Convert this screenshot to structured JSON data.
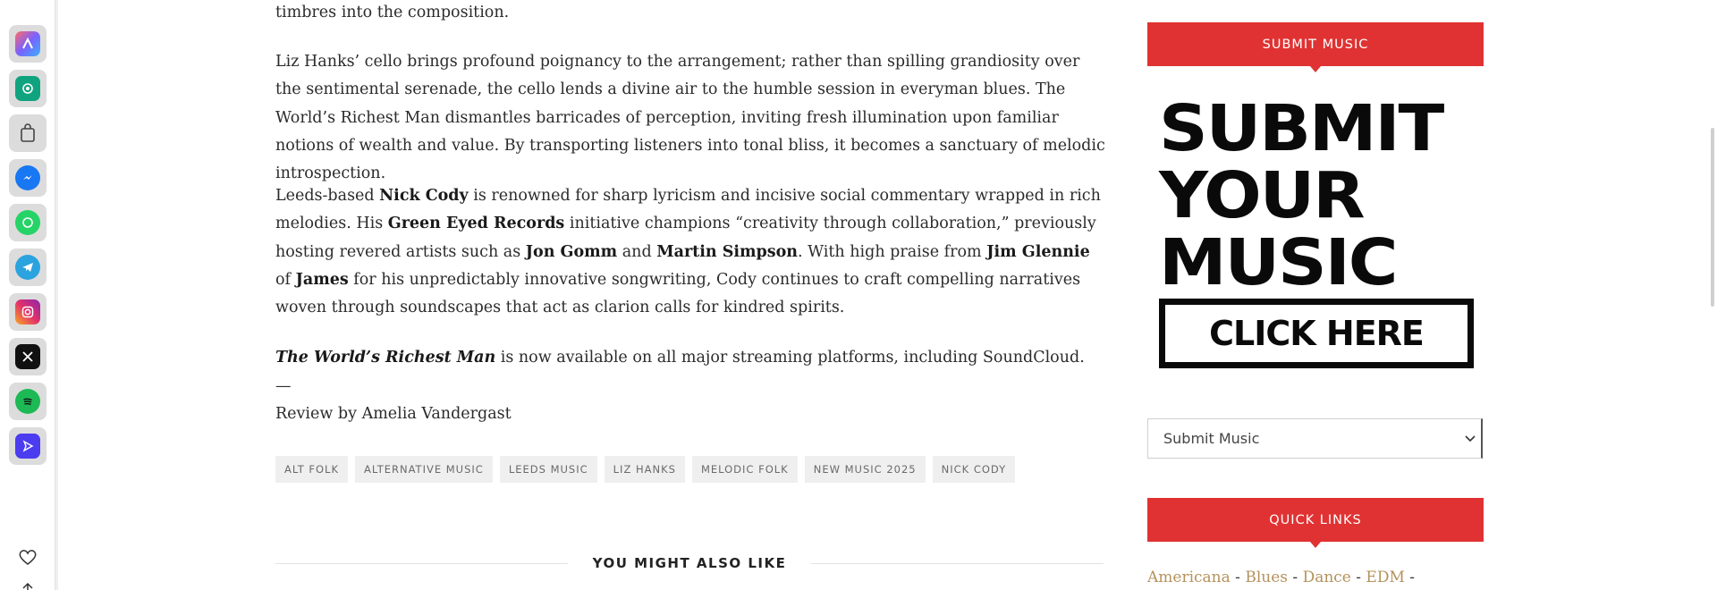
{
  "dock": {
    "items": [
      {
        "name": "arc-app-icon",
        "color": "#7b61ff"
      },
      {
        "name": "chatgpt-icon",
        "color": "#10a37f"
      },
      {
        "name": "shopping-bag-icon",
        "color": "#555555"
      },
      {
        "name": "messenger-icon",
        "color": "#1877f2"
      },
      {
        "name": "whatsapp-icon",
        "color": "#25d366"
      },
      {
        "name": "telegram-icon",
        "color": "#2aa3df"
      },
      {
        "name": "instagram-icon",
        "color": "#e1306c"
      },
      {
        "name": "x-icon",
        "color": "#111111"
      },
      {
        "name": "spotify-icon",
        "color": "#1db954"
      },
      {
        "name": "send-app-icon",
        "color": "#4b3cf0"
      }
    ],
    "bottom": [
      "heart-icon",
      "share-icon"
    ]
  },
  "article": {
    "p0": "timbres into the composition.",
    "p1": "Liz Hanks’ cello brings profound poignancy to the arrangement; rather than spilling grandiosity over the sentimental serenade, the cello lends a divine air to the humble session in everyman blues. The World’s Richest Man dismantles barricades of perception, inviting fresh illumination upon familiar notions of wealth and value. By transporting listeners into tonal bliss, it becomes a sanctuary of melodic introspection.",
    "p2": {
      "t1": "Leeds-based ",
      "b1": "Nick Cody",
      "t2": " is renowned for sharp lyricism and incisive social commentary wrapped in rich melodies. His ",
      "b2": "Green Eyed Records",
      "t3": " initiative champions “creativity through collaboration,” previously hosting revered artists such as ",
      "b3": "Jon Gomm",
      "t4": " and ",
      "b4": "Martin Simpson",
      "t5": ". With high praise from ",
      "b5": "Jim Glennie",
      "t6": " of ",
      "b6": "James",
      "t7": " for his unpredictably innovative songwriting, Cody continues to craft compelling narratives woven through soundscapes that act as clarion calls for kindred spirits."
    },
    "p3": {
      "title": "The World’s Richest Man",
      "rest": " is now available on all major streaming platforms, including SoundCloud."
    },
    "dash": "—",
    "byline": "Review by Amelia Vandergast"
  },
  "tags": [
    "ALT FOLK",
    "ALTERNATIVE MUSIC",
    "LEEDS MUSIC",
    "LIZ HANKS",
    "MELODIC FOLK",
    "NEW MUSIC 2025",
    "NICK CODY"
  ],
  "also_like": "YOU MIGHT ALSO LIKE",
  "sidebar": {
    "submit_banner": "SUBMIT MUSIC",
    "art_line1": "SUBMIT",
    "art_line2": "YOUR",
    "art_line3": "MUSIC",
    "art_button": "CLICK HERE",
    "select_value": "Submit Music",
    "quick_banner": "QUICK LINKS",
    "quick_links": [
      "Americana",
      "Blues",
      "Dance",
      "EDM"
    ],
    "separator": "-"
  },
  "colors": {
    "accent": "#e03232",
    "link": "#b4925c"
  }
}
